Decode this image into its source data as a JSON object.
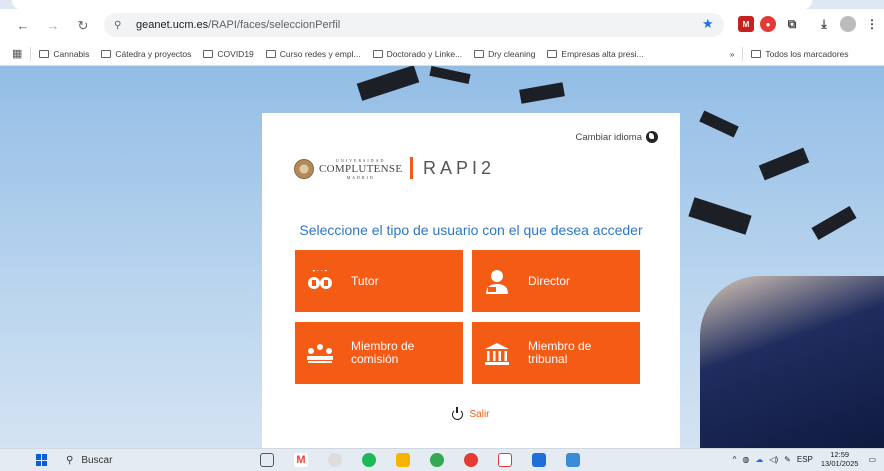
{
  "browser": {
    "url_host": "geanet.ucm.es",
    "url_path": "/RAPI/faces/seleccionPerfil",
    "bookmarks": [
      "Cannabis",
      "Cátedra y proyectos",
      "COVID19",
      "Curso redes y empl...",
      "Doctorado y Linke...",
      "Dry cleaning",
      "Empresas alta presi..."
    ],
    "overflow_label": "»",
    "all_bookmarks": "Todos los marcadores"
  },
  "card": {
    "language_link": "Cambiar idioma",
    "university_small": "UNIVERSIDAD",
    "university_big": "COMPLUTENSE",
    "university_city": "MADRID",
    "app_name": "RAPI2",
    "question": "Seleccione el tipo de usuario con el que desea acceder",
    "options": [
      {
        "label": "Tutor",
        "icon": "tutor-icon"
      },
      {
        "label": "Director",
        "icon": "director-icon"
      },
      {
        "label_line1": "Miembro de",
        "label_line2": "comisión",
        "icon": "committee-icon"
      },
      {
        "label_line1": "Miembro de",
        "label_line2": "tribunal",
        "icon": "court-icon"
      }
    ],
    "logout": "Salir"
  },
  "taskbar": {
    "search_label": "Buscar",
    "language": "ESP",
    "time": "12:59",
    "date": "13/01/2025"
  },
  "colors": {
    "accent": "#f45b15",
    "question": "#2d77c7"
  }
}
